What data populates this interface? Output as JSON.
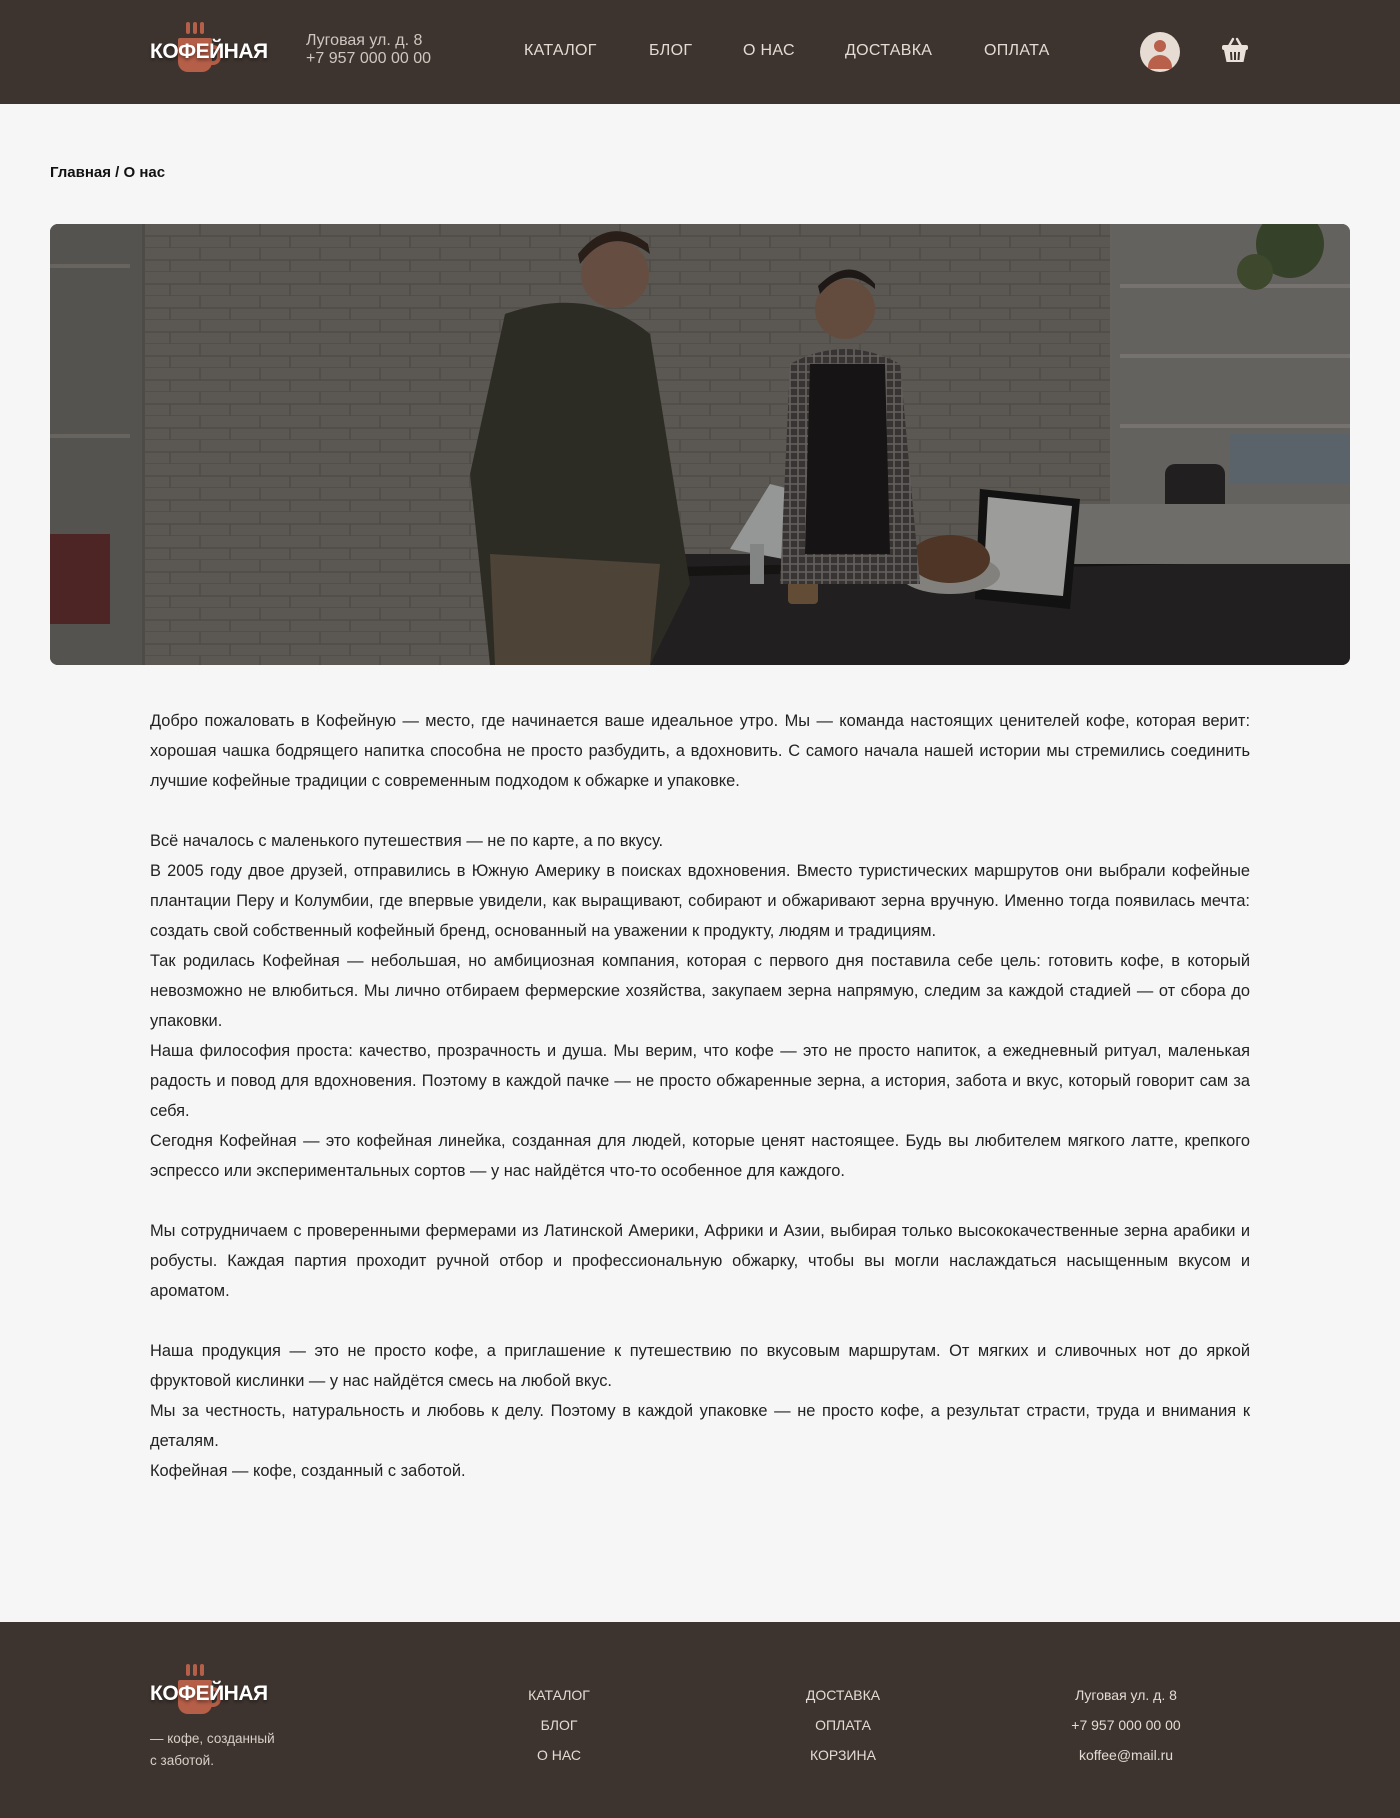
{
  "brand": {
    "name": "КОФЕЙНАЯ",
    "accent": "#b55e48",
    "header_bg": "#3e342f"
  },
  "header": {
    "address": "Луговая ул. д. 8",
    "phone": "+7 957 000 00 00",
    "nav": [
      "КАТАЛОГ",
      "БЛОГ",
      "О НАС",
      "ДОСТАВКА",
      "ОПЛАТА"
    ],
    "icons": {
      "profile": "user-icon",
      "cart": "basket-icon"
    }
  },
  "breadcrumb": {
    "home": "Главная",
    "separator": " / ",
    "current": "О нас"
  },
  "hero": {
    "image": "photo: customer paying barista at coffee shop counter"
  },
  "article": {
    "p1": "Добро пожаловать в Кофейную — место, где начинается ваше идеальное утро. Мы — команда настоящих ценителей кофе, которая верит: хорошая чашка бодрящего напитка способна не просто разбудить, а вдохновить. С самого начала нашей истории мы стремились соединить лучшие кофейные традиции с современным подходом к обжарке и упаковке.",
    "p2": "Всё началось с маленького путешествия — не по карте, а по вкусу.",
    "p3": "В 2005 году двое друзей, отправились в Южную Америку в поисках вдохновения. Вместо туристических маршрутов они выбрали кофейные плантации Перу и Колумбии, где впервые увидели, как выращивают, собирают и обжаривают зерна вручную. Именно тогда появилась мечта: создать свой собственный кофейный бренд, основанный на уважении к продукту, людям и традициям.",
    "p4": "Так родилась Кофейная — небольшая, но амбициозная компания, которая с первого дня поставила себе цель: готовить кофе, в который невозможно не влюбиться. Мы лично отбираем фермерские хозяйства, закупаем зерна напрямую, следим за каждой стадией — от сбора до упаковки.",
    "p5": "Наша философия проста: качество, прозрачность и душа. Мы верим, что кофе — это не просто напиток, а ежедневный ритуал, маленькая радость и повод для вдохновения. Поэтому в каждой пачке — не просто обжаренные зерна, а история, забота и вкус, который говорит сам за себя.",
    "p6": "Сегодня Кофейная — это кофейная линейка, созданная для людей, которые ценят настоящее. Будь вы любителем мягкого латте, крепкого эспрессо или экспериментальных сортов — у нас найдётся что-то особенное для каждого.",
    "p7": "Мы сотрудничаем с проверенными фермерами из Латинской Америки, Африки и Азии, выбирая только высококачественные зерна арабики и робусты. Каждая партия проходит ручной отбор и профессиональную обжарку, чтобы вы могли наслаждаться насыщенным вкусом и ароматом.",
    "p8": "Наша продукция — это не просто кофе, а приглашение к путешествию по вкусовым маршрутам. От мягких и сливочных нот до яркой фруктовой кислинки — у нас найдётся смесь на любой вкус.",
    "p9": "Мы за честность, натуральность и любовь к делу. Поэтому в каждой упаковке — не просто кофе, а результат страсти, труда и внимания к деталям.",
    "p10": "Кофейная — кофе, созданный с заботой."
  },
  "footer": {
    "tagline_1": "— кофе, созданный",
    "tagline_2": "с заботой.",
    "col1": [
      "КАТАЛОГ",
      "БЛОГ",
      "О НАС"
    ],
    "col2": [
      "ДОСТАВКА",
      "ОПЛАТА",
      "КОРЗИНА"
    ],
    "contacts": [
      "Луговая ул. д. 8",
      "+7 957 000 00 00",
      "koffee@mail.ru"
    ]
  }
}
